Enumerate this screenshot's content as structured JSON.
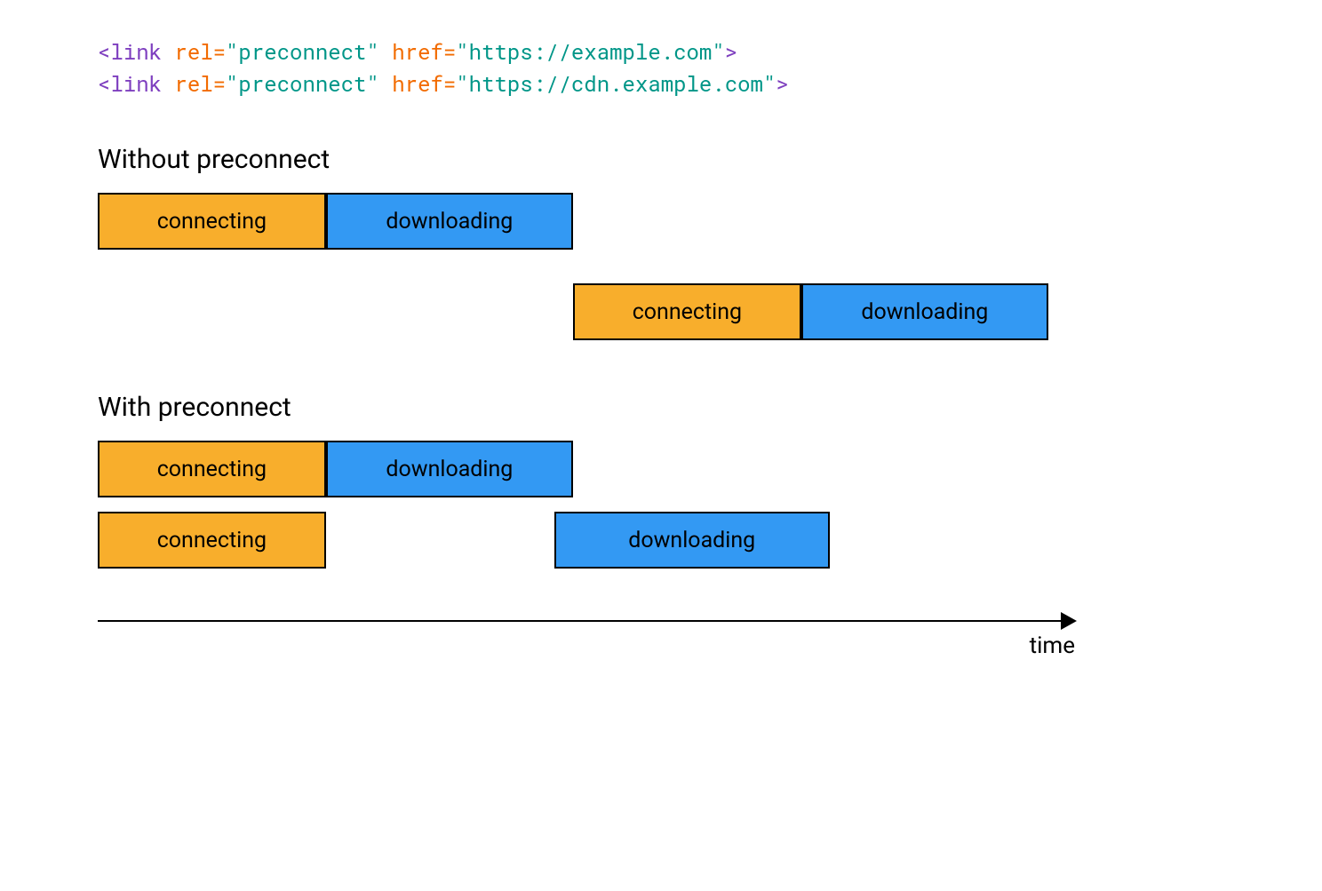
{
  "code": {
    "line1": {
      "open": "<link",
      "rel_attr": " rel=",
      "rel_val": "\"preconnect\"",
      "href_attr": " href=",
      "href_val": "\"https://example.com\"",
      "close": ">"
    },
    "line2": {
      "open": "<link",
      "rel_attr": " rel=",
      "rel_val": "\"preconnect\"",
      "href_attr": " href=",
      "href_val": "\"https://cdn.example.com\"",
      "close": ">"
    }
  },
  "sections": {
    "without": "Without preconnect",
    "with": "With preconnect"
  },
  "labels": {
    "connecting": "connecting",
    "downloading": "downloading",
    "time": "time"
  },
  "chart_data": {
    "type": "bar",
    "xlabel": "time",
    "units": "relative time units",
    "scenarios": [
      {
        "name": "Without preconnect",
        "rows": [
          {
            "segments": [
              {
                "phase": "connecting",
                "start": 0,
                "end": 24
              },
              {
                "phase": "downloading",
                "start": 24,
                "end": 50
              }
            ]
          },
          {
            "segments": [
              {
                "phase": "connecting",
                "start": 50,
                "end": 74
              },
              {
                "phase": "downloading",
                "start": 74,
                "end": 100
              }
            ]
          }
        ]
      },
      {
        "name": "With preconnect",
        "rows": [
          {
            "segments": [
              {
                "phase": "connecting",
                "start": 0,
                "end": 24
              },
              {
                "phase": "downloading",
                "start": 24,
                "end": 50
              }
            ]
          },
          {
            "segments": [
              {
                "phase": "connecting",
                "start": 0,
                "end": 24
              },
              {
                "phase": "downloading",
                "start": 48,
                "end": 77
              }
            ]
          }
        ]
      }
    ]
  }
}
